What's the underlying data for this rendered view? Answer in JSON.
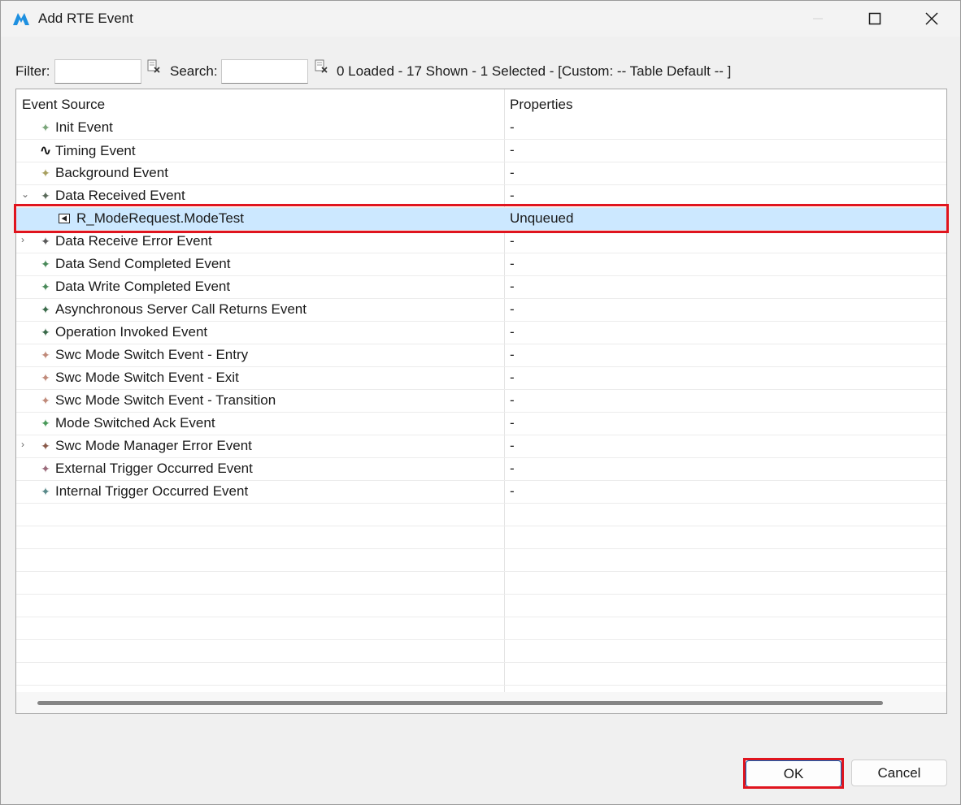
{
  "window": {
    "title": "Add RTE Event",
    "accent_color": "#0067c0"
  },
  "toolbar": {
    "filter_label": "Filter:",
    "filter_value": "",
    "search_label": "Search:",
    "search_value": "",
    "status_text": "0 Loaded - 17 Shown - 1 Selected -  [Custom: -- Table Default -- ]"
  },
  "table": {
    "columns": [
      "Event Source",
      "Properties"
    ],
    "rows": [
      {
        "label": "Init Event",
        "icon": "init-event-icon",
        "glyph": "✦",
        "color": "#7aa57a",
        "properties": "-",
        "level": 0,
        "expander": ""
      },
      {
        "label": "Timing Event",
        "icon": "timing-event-icon",
        "glyph": "∿",
        "color": "#111111",
        "properties": "-",
        "level": 0,
        "expander": ""
      },
      {
        "label": "Background Event",
        "icon": "background-event-icon",
        "glyph": "✦",
        "color": "#a8a060",
        "properties": "-",
        "level": 0,
        "expander": ""
      },
      {
        "label": "Data Received Event",
        "icon": "data-received-event-icon",
        "glyph": "✦",
        "color": "#5a6a5a",
        "properties": "-",
        "level": 0,
        "expander": "⌄"
      },
      {
        "label": "R_ModeRequest.ModeTest",
        "icon": "port-icon",
        "glyph": "",
        "color": "#222222",
        "properties": "Unqueued",
        "level": 1,
        "expander": "",
        "selected": true
      },
      {
        "label": "Data Receive Error Event",
        "icon": "data-receive-error-event-icon",
        "glyph": "✦",
        "color": "#5a5a5a",
        "properties": "-",
        "level": 0,
        "expander": "›"
      },
      {
        "label": "Data Send Completed Event",
        "icon": "data-send-completed-event-icon",
        "glyph": "✦",
        "color": "#4a8a5a",
        "properties": "-",
        "level": 0,
        "expander": ""
      },
      {
        "label": "Data Write Completed Event",
        "icon": "data-write-completed-event-icon",
        "glyph": "✦",
        "color": "#4a8a5a",
        "properties": "-",
        "level": 0,
        "expander": ""
      },
      {
        "label": "Asynchronous Server Call Returns Event",
        "icon": "async-server-call-returns-event-icon",
        "glyph": "✦",
        "color": "#3a6a4a",
        "properties": "-",
        "level": 0,
        "expander": ""
      },
      {
        "label": "Operation Invoked Event",
        "icon": "operation-invoked-event-icon",
        "glyph": "✦",
        "color": "#3a6a4a",
        "properties": "-",
        "level": 0,
        "expander": ""
      },
      {
        "label": "Swc Mode Switch Event - Entry",
        "icon": "mode-switch-entry-event-icon",
        "glyph": "✦",
        "color": "#c08a7a",
        "properties": "-",
        "level": 0,
        "expander": ""
      },
      {
        "label": "Swc Mode Switch Event - Exit",
        "icon": "mode-switch-exit-event-icon",
        "glyph": "✦",
        "color": "#c08a7a",
        "properties": "-",
        "level": 0,
        "expander": ""
      },
      {
        "label": "Swc Mode Switch Event - Transition",
        "icon": "mode-switch-transition-event-icon",
        "glyph": "✦",
        "color": "#c08a7a",
        "properties": "-",
        "level": 0,
        "expander": ""
      },
      {
        "label": "Mode Switched Ack Event",
        "icon": "mode-switched-ack-event-icon",
        "glyph": "✦",
        "color": "#4a9a5a",
        "properties": "-",
        "level": 0,
        "expander": ""
      },
      {
        "label": "Swc Mode Manager Error Event",
        "icon": "mode-manager-error-event-icon",
        "glyph": "✦",
        "color": "#8a5a4a",
        "properties": "-",
        "level": 0,
        "expander": "›"
      },
      {
        "label": "External Trigger Occurred Event",
        "icon": "external-trigger-event-icon",
        "glyph": "✦",
        "color": "#9a6a7a",
        "properties": "-",
        "level": 0,
        "expander": ""
      },
      {
        "label": "Internal Trigger Occurred Event",
        "icon": "internal-trigger-event-icon",
        "glyph": "✦",
        "color": "#5a8a8a",
        "properties": "-",
        "level": 0,
        "expander": ""
      }
    ]
  },
  "buttons": {
    "ok": "OK",
    "cancel": "Cancel"
  }
}
